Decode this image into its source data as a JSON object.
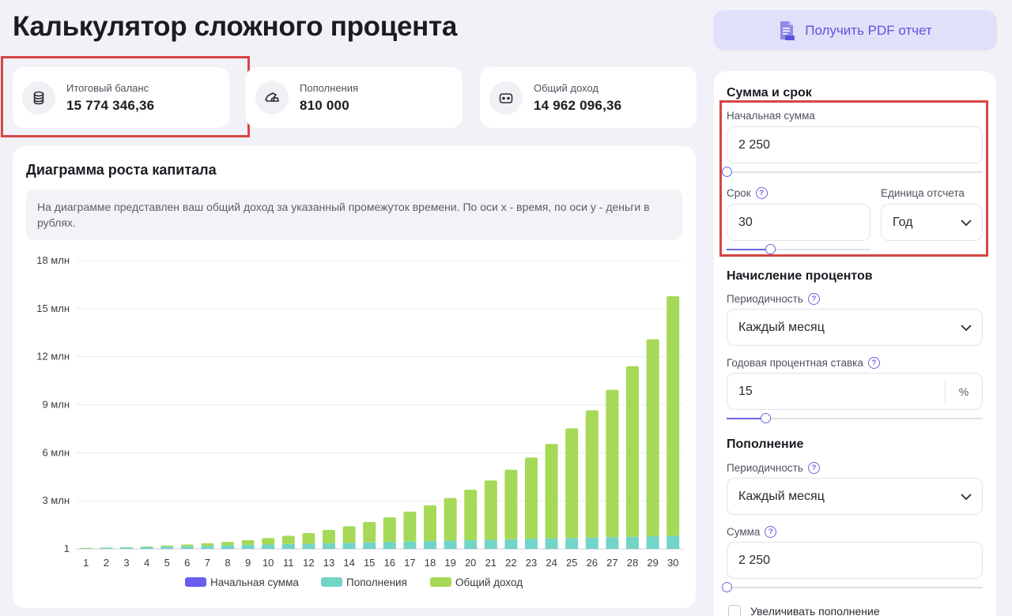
{
  "page_title": "Калькулятор сложного процента",
  "pdf_button_label": "Получить PDF отчет",
  "stats": [
    {
      "label": "Итоговый баланс",
      "value": "15 774 346,36"
    },
    {
      "label": "Пополнения",
      "value": "810 000"
    },
    {
      "label": "Общий доход",
      "value": "14 962 096,36"
    }
  ],
  "chart_card": {
    "title": "Диаграмма роста капитала",
    "note": "На диаграмме представлен ваш общий доход за указанный промежуток времени. По оси x - время, по оси y - деньги в рублях."
  },
  "chart_data": {
    "type": "bar",
    "stacked": true,
    "categories": [
      "1",
      "2",
      "3",
      "4",
      "5",
      "6",
      "7",
      "8",
      "9",
      "10",
      "11",
      "12",
      "13",
      "14",
      "15",
      "16",
      "17",
      "18",
      "19",
      "20",
      "21",
      "22",
      "23",
      "24",
      "25",
      "26",
      "27",
      "28",
      "29",
      "30"
    ],
    "y_ticks": [
      "1",
      "3 млн",
      "6 млн",
      "9 млн",
      "12 млн",
      "15 млн",
      "18 млн"
    ],
    "ylim": [
      0,
      18000000
    ],
    "series": [
      {
        "name": "Начальная сумма",
        "color": "#6b5cf0",
        "values": [
          2250,
          2250,
          2250,
          2250,
          2250,
          2250,
          2250,
          2250,
          2250,
          2250,
          2250,
          2250,
          2250,
          2250,
          2250,
          2250,
          2250,
          2250,
          2250,
          2250,
          2250,
          2250,
          2250,
          2250,
          2250,
          2250,
          2250,
          2250,
          2250,
          2250
        ]
      },
      {
        "name": "Пополнения",
        "color": "#73d4c8",
        "values": [
          27000,
          54000,
          81000,
          108000,
          135000,
          162000,
          189000,
          216000,
          243000,
          270000,
          297000,
          324000,
          351000,
          378000,
          405000,
          432000,
          459000,
          486000,
          513000,
          540000,
          567000,
          594000,
          621000,
          648000,
          675000,
          702000,
          729000,
          756000,
          783000,
          810000
        ]
      },
      {
        "name": "Общий доход",
        "color": "#a6d957",
        "values": [
          2200,
          9500,
          22700,
          43000,
          72000,
          110000,
          160000,
          220000,
          300000,
          400000,
          520000,
          660000,
          830000,
          1030000,
          1270000,
          1540000,
          1860000,
          2230000,
          2660000,
          3150000,
          3700000,
          4350000,
          5080000,
          5900000,
          6850000,
          7950000,
          9200000,
          10650000,
          12300000,
          14962096
        ]
      }
    ],
    "legend_position": "bottom",
    "grid": true
  },
  "sidebar": {
    "section_term": "Сумма и срок",
    "initial_sum": {
      "label": "Начальная сумма",
      "value": "2 250",
      "level": 0.0
    },
    "term": {
      "label": "Срок",
      "value": "30",
      "level": 0.3
    },
    "unit": {
      "label": "Единица отсчета",
      "value": "Год"
    },
    "section_interest": "Начисление процентов",
    "interest_period": {
      "label": "Периодичность",
      "value": "Каждый месяц"
    },
    "rate": {
      "label": "Годовая процентная ставка",
      "value": "15",
      "unit": "%",
      "level": 0.15
    },
    "section_topup": "Пополнение",
    "topup_period": {
      "label": "Периодичность",
      "value": "Каждый месяц"
    },
    "topup_sum": {
      "label": "Сумма",
      "value": "2 250",
      "level": 0.0
    },
    "increase_topup_label": "Увеличивать пополнение"
  },
  "colors": {
    "accent": "#6a64e0",
    "highlight": "#d64545",
    "background": "#f1f1f7"
  }
}
